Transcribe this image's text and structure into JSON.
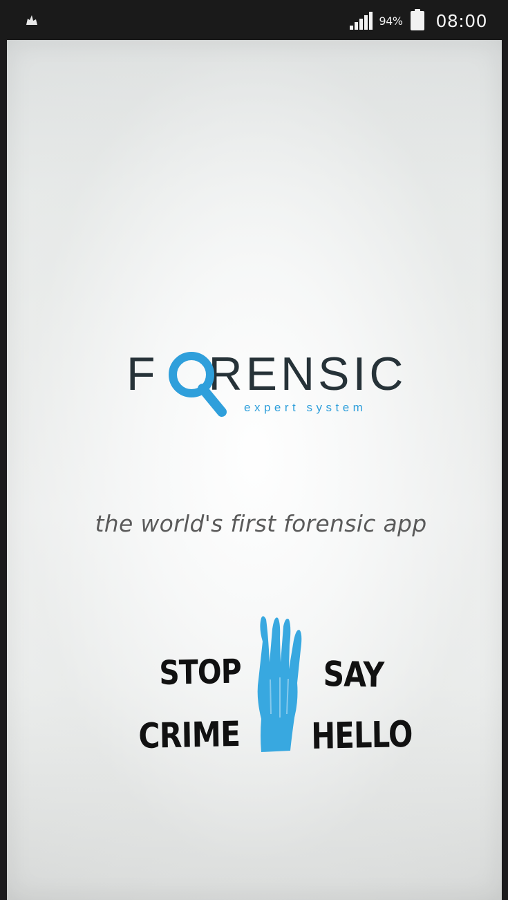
{
  "status_bar": {
    "left_icon": "notification-icon",
    "signal_icon": "signal-icon",
    "battery_percent": "94%",
    "battery_icon": "battery-icon",
    "time": "08:00"
  },
  "splash": {
    "logo": {
      "word_start": "F",
      "word_end": "RENSIC",
      "subtitle": "expert system",
      "icon": "magnifier-icon",
      "accent_color": "#2f9fdb",
      "text_color": "#263238"
    },
    "tagline": "the world's first forensic app",
    "campaign": {
      "stop": "STOP",
      "crime": "CRIME",
      "say": "SAY",
      "hello": "HELLO",
      "icon": "hand-icon",
      "hand_color": "#38a8e0"
    }
  }
}
